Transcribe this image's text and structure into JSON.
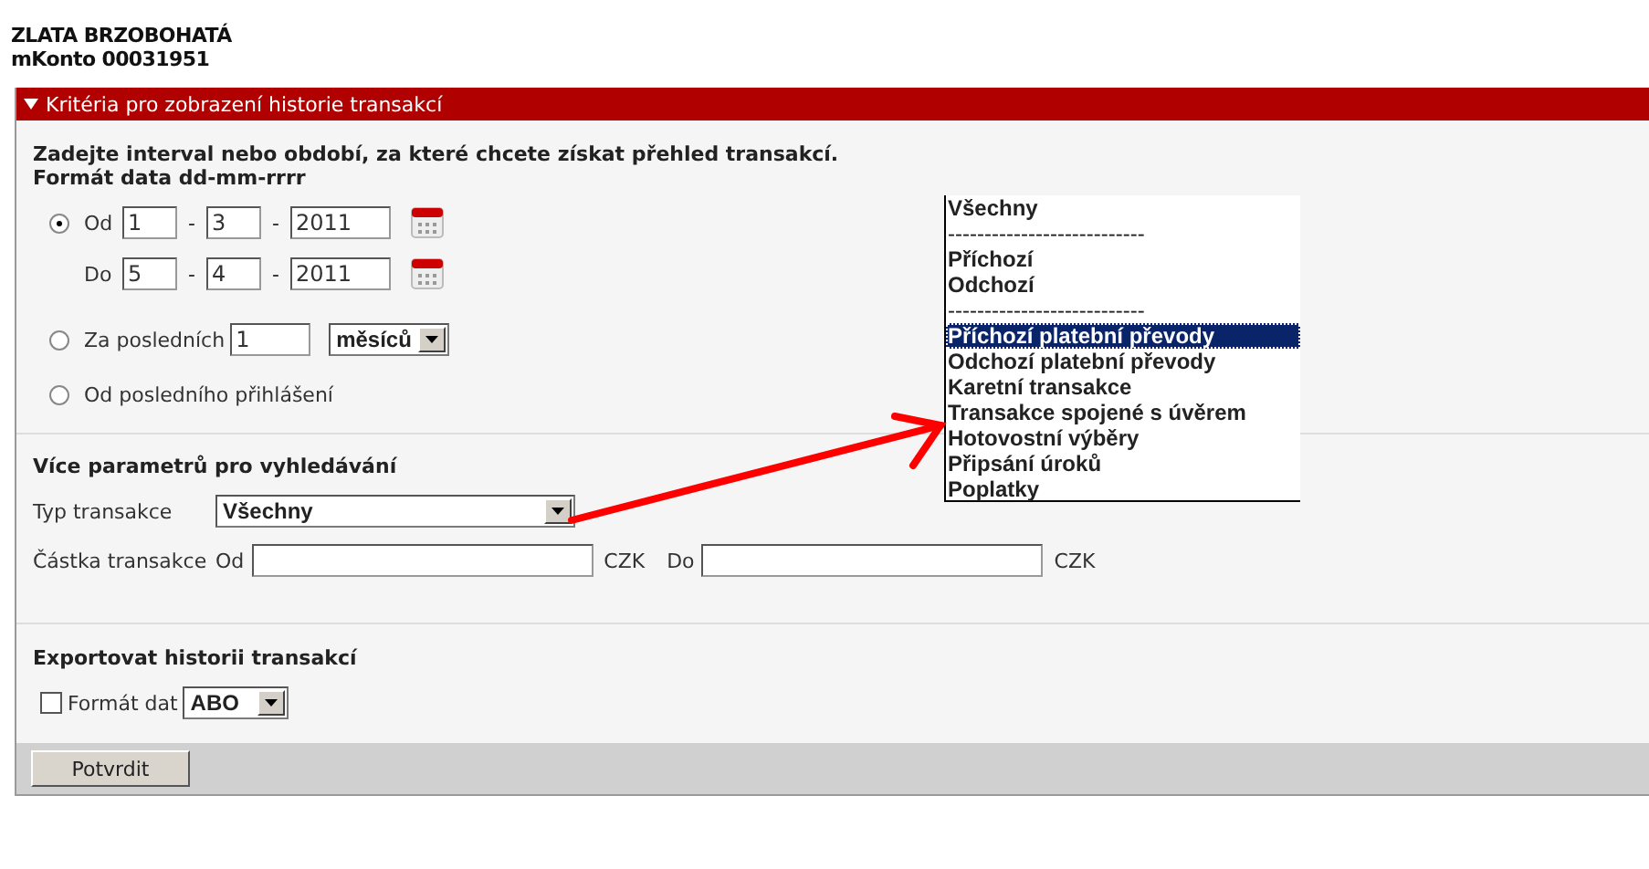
{
  "account": {
    "name": "ZLATA BRZOBOHATÁ",
    "number": "mKonto 00031951"
  },
  "panel": {
    "title": "Kritéria pro zobrazení historie transakcí",
    "expanded": true
  },
  "period": {
    "instructions": "Zadejte interval nebo období, za které chcete získat přehled transakcí.",
    "format_hint": "Formát data dd-mm-rrrr",
    "options": [
      {
        "kind": "range",
        "selected": true,
        "rows": [
          {
            "label": "Od",
            "day": "1",
            "month": "3",
            "year": "2011",
            "separators": [
              "-",
              "-"
            ]
          },
          {
            "label": "Do",
            "day": "5",
            "month": "4",
            "year": "2011",
            "separators": [
              "-",
              "-"
            ]
          }
        ]
      },
      {
        "kind": "last",
        "selected": false,
        "label": "Za posledních",
        "value": "1",
        "unit": "měsíců"
      },
      {
        "kind": "since_login",
        "selected": false,
        "label": "Od posledního přihlášení"
      }
    ]
  },
  "filters": {
    "title": "Více parametrů pro vyhledávání",
    "type_label": "Typ transakce",
    "type_value": "Všechny",
    "amount_label": "Částka transakce",
    "amount_from": {
      "label": "Od",
      "currency": "CZK"
    },
    "amount_to": {
      "label": "Do",
      "currency": "CZK"
    }
  },
  "export": {
    "title": "Exportovat historii transakcí",
    "checked": false,
    "label": "Formát dat",
    "format": "ABO"
  },
  "submit": "Potvrdit",
  "dropdown_list": {
    "items": [
      {
        "kind": "option",
        "label": "Všechny",
        "selected": false
      },
      {
        "kind": "separator",
        "label": "---------------------------",
        "selected": false
      },
      {
        "kind": "option",
        "label": "Příchozí",
        "selected": false
      },
      {
        "kind": "option",
        "label": "Odchozí",
        "selected": false
      },
      {
        "kind": "separator",
        "label": "---------------------------",
        "selected": false
      },
      {
        "kind": "option",
        "label": "Příchozí platební převody",
        "selected": true
      },
      {
        "kind": "option",
        "label": "Odchozí platební převody",
        "selected": false
      },
      {
        "kind": "option",
        "label": "Karetní transakce",
        "selected": false
      },
      {
        "kind": "option",
        "label": "Transakce spojené s úvěrem",
        "selected": false
      },
      {
        "kind": "option",
        "label": "Hotovostní výběry",
        "selected": false
      },
      {
        "kind": "option",
        "label": "Připsání úroků",
        "selected": false
      },
      {
        "kind": "option",
        "label": "Poplatky",
        "selected": false
      }
    ]
  }
}
